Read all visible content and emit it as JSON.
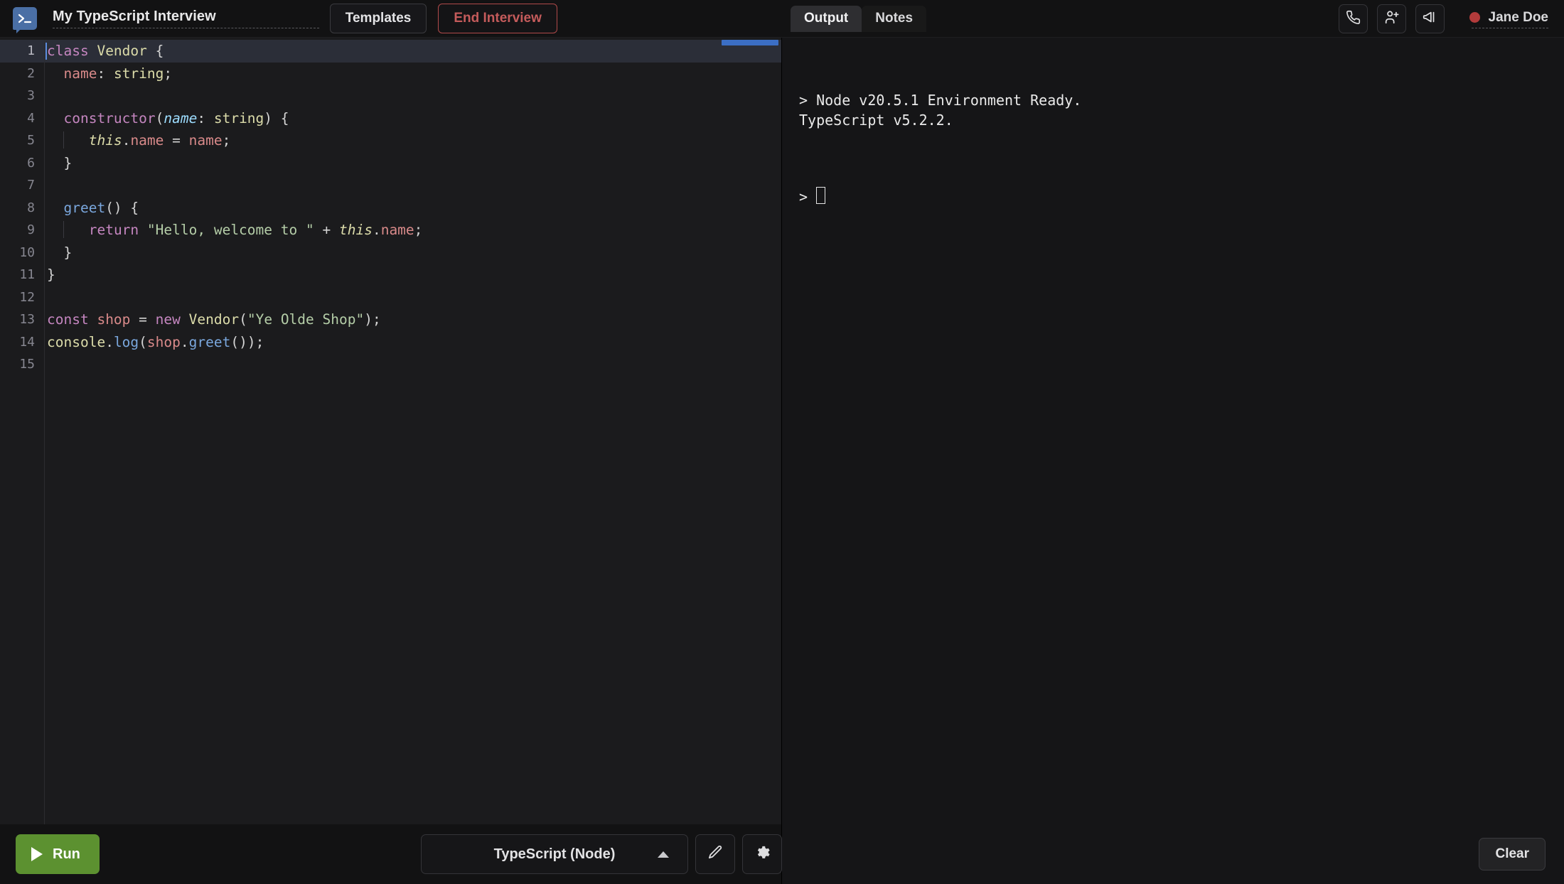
{
  "header": {
    "logo_icon": "terminal-prompt-logo",
    "project_title": "My TypeScript Interview",
    "templates_label": "Templates",
    "end_interview_label": "End Interview",
    "tabs": [
      {
        "label": "Output",
        "active": true
      },
      {
        "label": "Notes",
        "active": false
      }
    ],
    "actions": [
      {
        "icon": "phone-icon"
      },
      {
        "icon": "add-person-icon"
      },
      {
        "icon": "megaphone-icon"
      }
    ],
    "recording_dot_color": "#b23b3b",
    "user_name": "Jane Doe"
  },
  "editor": {
    "lines": [
      {
        "num": "1",
        "current": true
      },
      {
        "num": "2",
        "current": false
      },
      {
        "num": "3",
        "current": false
      },
      {
        "num": "4",
        "current": false
      },
      {
        "num": "5",
        "current": false
      },
      {
        "num": "6",
        "current": false
      },
      {
        "num": "7",
        "current": false
      },
      {
        "num": "8",
        "current": false
      },
      {
        "num": "9",
        "current": false
      },
      {
        "num": "10",
        "current": false
      },
      {
        "num": "11",
        "current": false
      },
      {
        "num": "12",
        "current": false
      },
      {
        "num": "13",
        "current": false
      },
      {
        "num": "14",
        "current": false
      },
      {
        "num": "15",
        "current": false
      }
    ],
    "code_text": [
      "class Vendor {",
      "  name: string;",
      "",
      "  constructor(name: string) {",
      "    this.name = name;",
      "  }",
      "",
      "  greet() {",
      "    return \"Hello, welcome to \" + this.name;",
      "  }",
      "}",
      "",
      "const shop = new Vendor(\"Ye Olde Shop\");",
      "console.log(shop.greet());",
      ""
    ]
  },
  "editor_bar": {
    "run_label": "Run",
    "language": "TypeScript (Node)",
    "edit_icon": "pencil-icon",
    "settings_icon": "gear-icon"
  },
  "output": {
    "terminal_lines": "> Node v20.5.1 Environment Ready.\nTypeScript v5.2.2.",
    "prompt_symbol": ">",
    "clear_label": "Clear"
  }
}
